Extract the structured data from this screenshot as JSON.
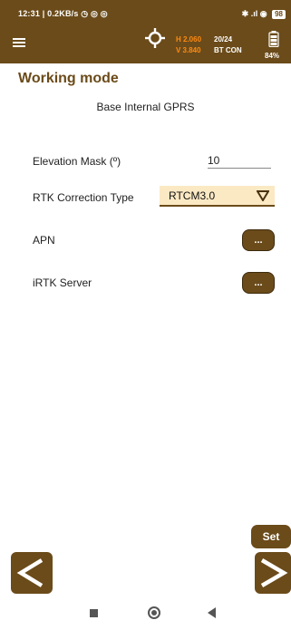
{
  "status_bar": {
    "left": "12:31 | 0.2KB/s ◷ ◎ ◎",
    "right": "✱ .ıl ◉",
    "battery": "98"
  },
  "app_bar": {
    "h_value": "H 2.060",
    "v_value": "V 3.840",
    "satellites": "20/24",
    "connection": "BT CON",
    "battery_pct": "84%"
  },
  "page": {
    "title": "Working mode",
    "mode": "Base Internal GPRS"
  },
  "form": {
    "elevation_label": "Elevation Mask (º)",
    "elevation_value": "10",
    "rtk_label": "RTK Correction Type",
    "rtk_value": "RTCM3.0",
    "apn_label": "APN",
    "apn_button": "...",
    "irtk_label": "iRTK Server",
    "irtk_button": "..."
  },
  "footer": {
    "set_label": "Set"
  },
  "colors": {
    "brand": "#6b4b1a",
    "accent": "#ff8a10",
    "select_bg": "#fbe9c4"
  },
  "icons": {
    "menu": "hamburger-icon",
    "target": "crosshair-icon",
    "battery": "battery-icon",
    "prev": "chevron-left-icon",
    "next": "chevron-right-icon"
  }
}
